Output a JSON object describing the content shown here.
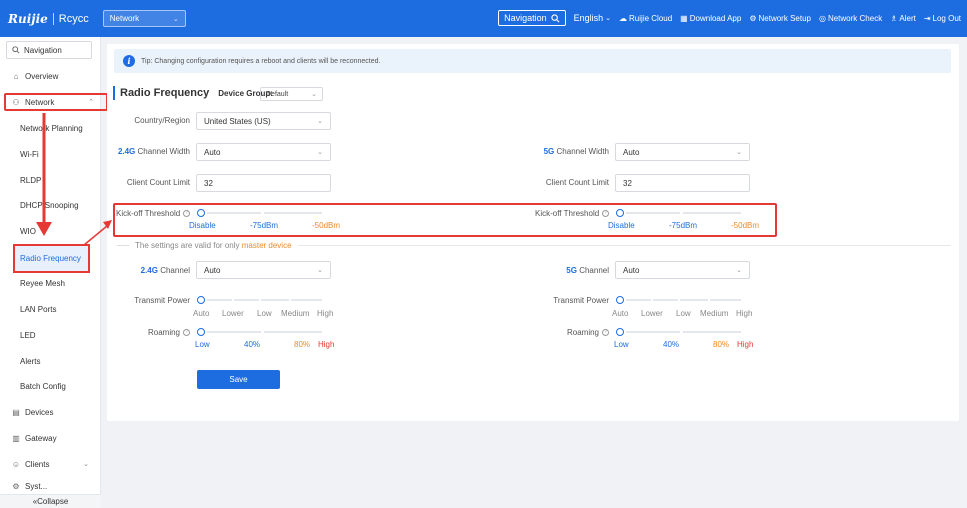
{
  "header": {
    "brand": "Ruijie",
    "brand_sub": "Rcycc",
    "network_select": "Network",
    "navigation": "Navigation",
    "language": "English",
    "links": [
      "Ruijie Cloud",
      "Download App",
      "Network Setup",
      "Network Check",
      "Alert",
      "Log Out"
    ]
  },
  "sidebar": {
    "search_label": "Navigation",
    "items": [
      {
        "label": "Overview",
        "icon": "home-icon"
      },
      {
        "label": "Network",
        "icon": "network-icon"
      },
      {
        "label": "Network Planning"
      },
      {
        "label": "Wi-Fi"
      },
      {
        "label": "RLDP"
      },
      {
        "label": "DHCP Snooping"
      },
      {
        "label": "WIO"
      },
      {
        "label": "Radio Frequency"
      },
      {
        "label": "Reyee Mesh"
      },
      {
        "label": "LAN Ports"
      },
      {
        "label": "LED"
      },
      {
        "label": "Alerts"
      },
      {
        "label": "Batch Config"
      },
      {
        "label": "Devices",
        "icon": "devices-icon"
      },
      {
        "label": "Gateway",
        "icon": "gateway-icon"
      },
      {
        "label": "Clients",
        "icon": "clients-icon"
      },
      {
        "label": "Syst...",
        "icon": "system-icon"
      }
    ],
    "collapse": "Collapse"
  },
  "main": {
    "tip": "Tip: Changing configuration requires a reboot and clients will be reconnected.",
    "title": "Radio Frequency",
    "device_group_label": "Device Group:",
    "device_group_value": "Default",
    "country_label": "Country/Region",
    "country_value": "United States (US)",
    "ch_width_24_prefix": "2.4G",
    "ch_width_label": "Channel Width",
    "ch_width_24_value": "Auto",
    "ch_width_5_prefix": "5G",
    "ch_width_5_value": "Auto",
    "client_limit_label": "Client Count Limit",
    "client_limit_24": "32",
    "client_limit_5": "32",
    "kickoff_label": "Kick-off Threshold",
    "kickoff_marks": [
      "Disable",
      "-75dBm",
      "-50dBm"
    ],
    "valid_prefix": "The settings are valid for only",
    "valid_highlight": "master device",
    "channel_24_prefix": "2.4G",
    "channel_label": "Channel",
    "channel_24_value": "Auto",
    "channel_5_prefix": "5G",
    "channel_5_value": "Auto",
    "tx_power_label": "Transmit Power",
    "tx_power_marks": [
      "Auto",
      "Lower",
      "Low",
      "Medium",
      "High"
    ],
    "roaming_label": "Roaming",
    "roaming_marks": [
      "Low",
      "40%",
      "80%",
      "High"
    ],
    "save": "Save"
  },
  "colors": {
    "primary": "#1e6de0",
    "highlight_red": "#e53935",
    "orange": "#f08a24"
  }
}
